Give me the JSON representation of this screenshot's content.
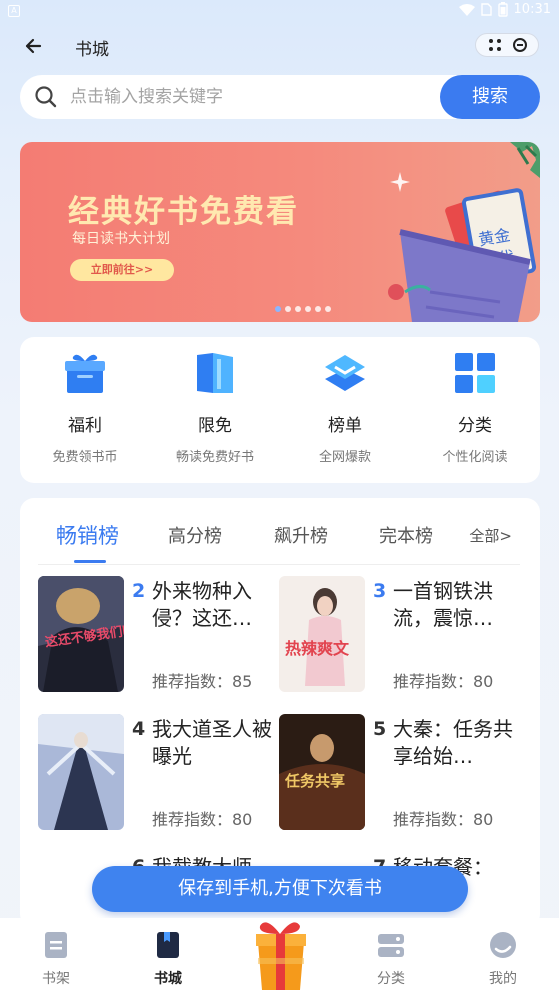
{
  "status_bar": {
    "time": "10:31"
  },
  "header": {
    "title": "书城"
  },
  "search": {
    "placeholder": "点击输入搜索关键字",
    "button_label": "搜索"
  },
  "banner": {
    "title": "经典好书免费看",
    "subtitle": "每日读书大计划",
    "cta_label": "立即前往>>"
  },
  "quick_nav": [
    {
      "label": "福利",
      "sub": "免费领书币",
      "icon": "gift-icon"
    },
    {
      "label": "限免",
      "sub": "畅读免费好书",
      "icon": "book-open-icon"
    },
    {
      "label": "榜单",
      "sub": "全网爆款",
      "icon": "layers-icon"
    },
    {
      "label": "分类",
      "sub": "个性化阅读",
      "icon": "grid-icon"
    }
  ],
  "ranking": {
    "tabs": [
      "畅销榜",
      "高分榜",
      "飙升榜",
      "完本榜"
    ],
    "active_tab": "畅销榜",
    "all_label": "全部>",
    "books": [
      {
        "rank": "2",
        "title": "外来物种入侵？这还…",
        "score": "推荐指数：85",
        "rank_color": "#3b7bf0"
      },
      {
        "rank": "3",
        "title": "一首钢铁洪流，震惊…",
        "score": "推荐指数：80",
        "rank_color": "#3b7bf0"
      },
      {
        "rank": "4",
        "title": "我大道圣人被曝光",
        "score": "推荐指数：80",
        "rank_color": "#333333"
      },
      {
        "rank": "5",
        "title": "大秦：任务共享给始…",
        "score": "推荐指数：80",
        "rank_color": "#333333"
      },
      {
        "rank": "6",
        "title": "我截教大师",
        "score": "",
        "rank_color": "#333333"
      },
      {
        "rank": "7",
        "title": "移动套餐：电…",
        "score": "",
        "rank_color": "#333333"
      }
    ],
    "cover_texts": {
      "book2": "这还不够我们吃",
      "book3": "热辣爽文",
      "book5": "任务共享"
    }
  },
  "save_banner": {
    "label": "保存到手机,方便下次看书"
  },
  "bottom_nav": [
    {
      "label": "书架",
      "icon": "bookshelf-icon"
    },
    {
      "label": "书城",
      "icon": "bookstore-icon"
    },
    {
      "label": "分类",
      "icon": "category-icon"
    },
    {
      "label": "我的",
      "icon": "profile-icon"
    }
  ],
  "colors": {
    "accent": "#3b7bf0",
    "banner": "#f47c73"
  }
}
